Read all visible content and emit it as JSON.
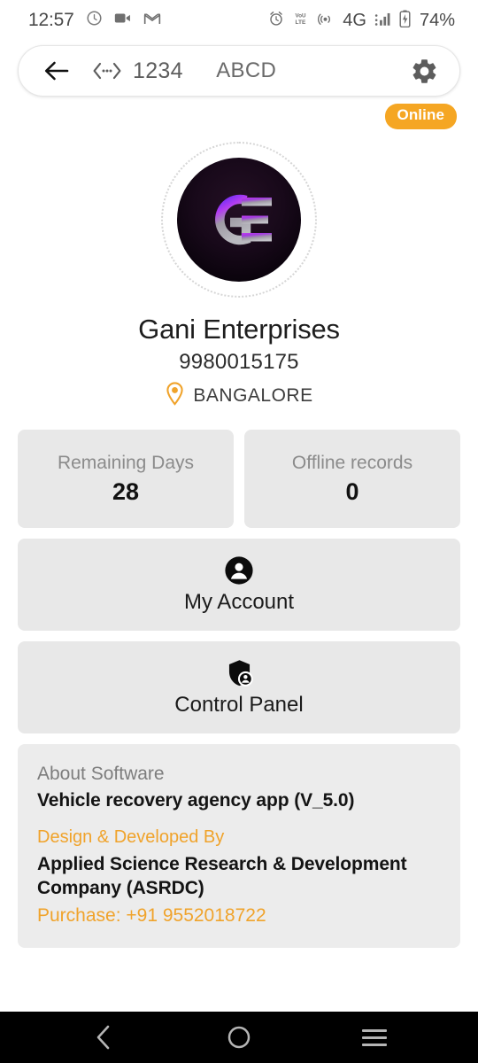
{
  "status_bar": {
    "time": "12:57",
    "left_icons": [
      "clock-app-icon",
      "video-camera-icon",
      "gmail-icon"
    ],
    "right_icons": [
      "alarm-icon",
      "volte-icon",
      "hotspot-icon",
      "signal-bars-icon",
      "battery-icon"
    ],
    "network_type": "4G",
    "battery_percent": "74%"
  },
  "header": {
    "back_icon": "arrow-left-icon",
    "code_icon": "code-brackets-icon",
    "number": "1234",
    "title": "ABCD",
    "settings_icon": "gear-icon"
  },
  "status_badge": {
    "label": "Online",
    "color": "#f5a623"
  },
  "profile": {
    "logo_initials": "GE",
    "name": "Gani Enterprises",
    "phone": "9980015175",
    "location": "BANGALORE",
    "location_icon": "location-pin-icon",
    "location_icon_color": "#f0a32b"
  },
  "stats": [
    {
      "label": "Remaining Days",
      "value": "28"
    },
    {
      "label": "Offline records",
      "value": "0"
    }
  ],
  "actions": [
    {
      "label": "My Account",
      "icon": "account-circle-icon"
    },
    {
      "label": "Control Panel",
      "icon": "shield-user-icon"
    }
  ],
  "about": {
    "heading": "About Software",
    "product": "Vehicle recovery agency app (V_5.0)",
    "developed_by_label": "Design & Developed By",
    "company": "Applied Science Research & Development Company (ASRDC)",
    "purchase": "Purchase: +91 9552018722",
    "accent_color": "#f0a32b"
  },
  "navbar": {
    "back_icon": "nav-back-icon",
    "home_icon": "nav-home-icon",
    "recents_icon": "nav-recents-icon"
  }
}
